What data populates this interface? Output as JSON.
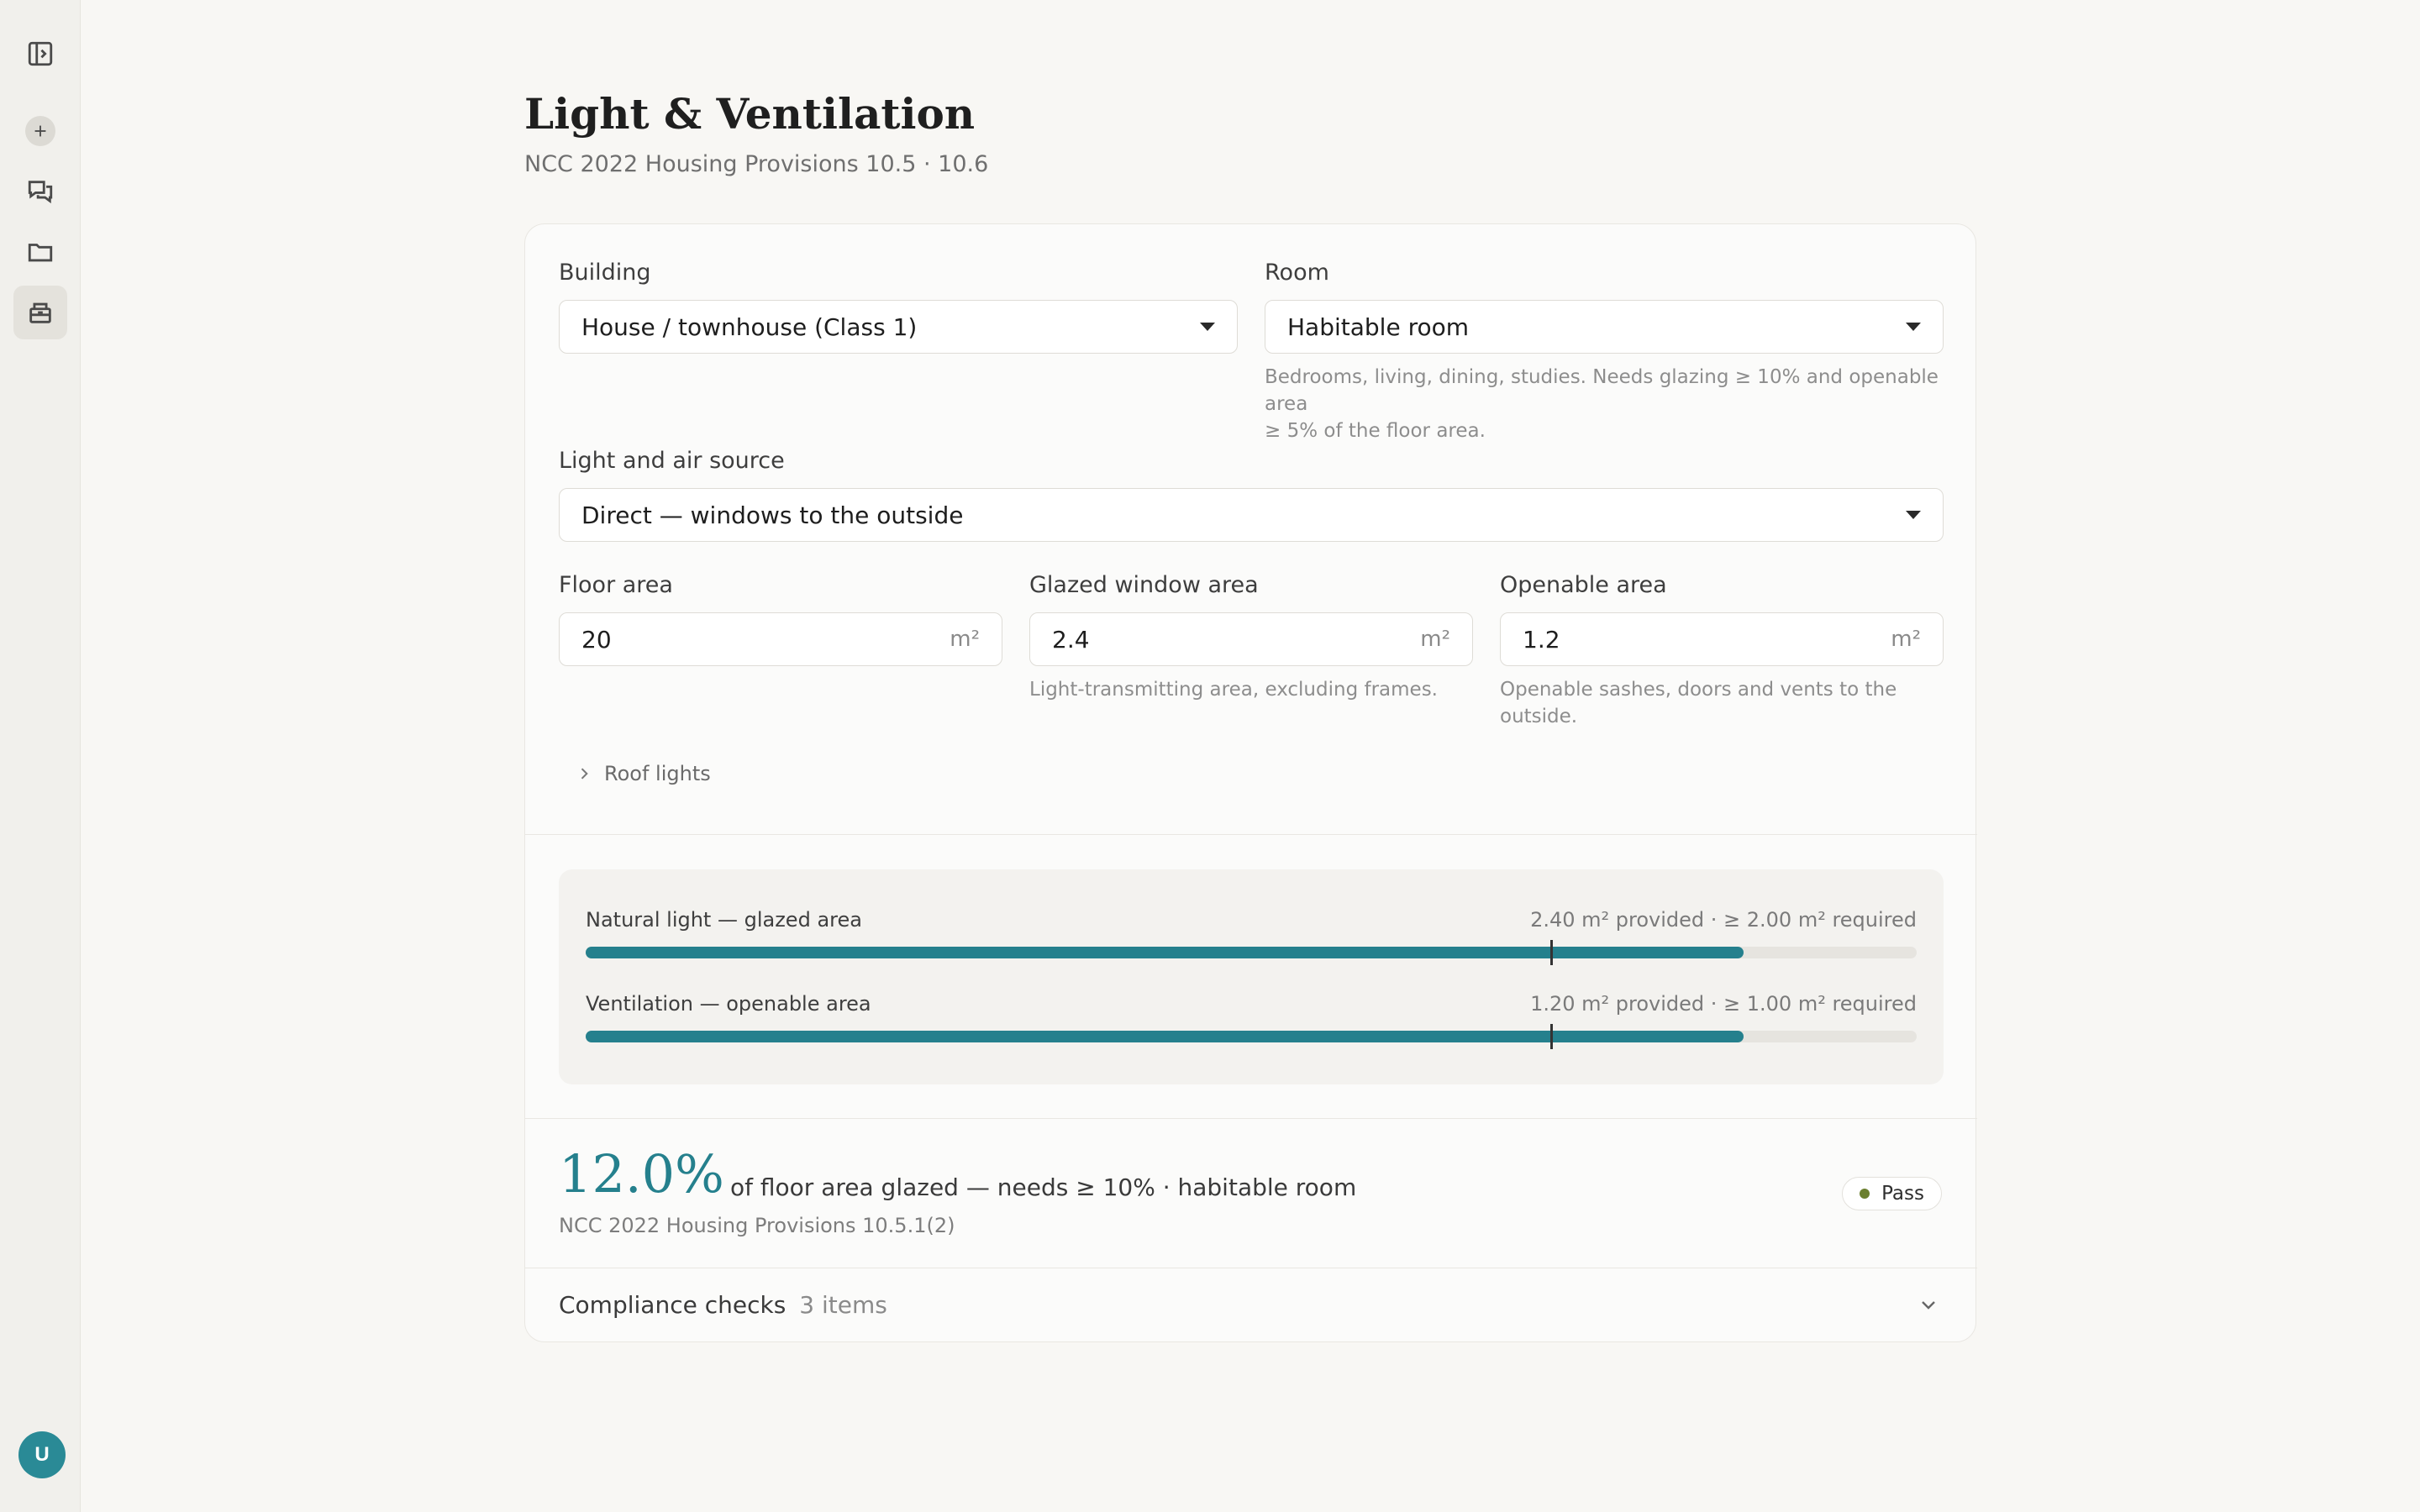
{
  "sidebar": {
    "items": [
      {
        "name": "toggle-sidebar-icon"
      },
      {
        "name": "new-chat-icon"
      },
      {
        "name": "chats-icon"
      },
      {
        "name": "projects-icon"
      },
      {
        "name": "tools-icon"
      }
    ],
    "avatar_initial": "U"
  },
  "header": {
    "title": "Light & Ventilation",
    "subtitle": "NCC 2022 Housing Provisions 10.5 · 10.6"
  },
  "form": {
    "building": {
      "label": "Building",
      "value": "House / townhouse (Class 1)"
    },
    "room": {
      "label": "Room",
      "value": "Habitable room",
      "help_line1": "Bedrooms, living, dining, studies. Needs glazing ≥ 10% and openable area",
      "help_line2": "≥ 5% of the floor area."
    },
    "source": {
      "label": "Light and air source",
      "value": "Direct — windows to the outside"
    },
    "floor_area": {
      "label": "Floor area",
      "value": "20",
      "unit": "m²"
    },
    "glazed_area": {
      "label": "Glazed window area",
      "value": "2.4",
      "unit": "m²",
      "help": "Light-transmitting area, excluding frames."
    },
    "openable_area": {
      "label": "Openable area",
      "value": "1.2",
      "unit": "m²",
      "help_line1": "Openable sashes, doors and vents to the",
      "help_line2": "outside."
    },
    "roof_lights_label": "Roof lights"
  },
  "meters": [
    {
      "label": "Natural light — glazed area",
      "readout": "2.40 m² provided · ≥ 2.00 m² required",
      "fill_fraction": 0.87,
      "threshold_fraction": 0.725
    },
    {
      "label": "Ventilation — openable area",
      "readout": "1.20 m² provided · ≥ 1.00 m² required",
      "fill_fraction": 0.87,
      "threshold_fraction": 0.725
    }
  ],
  "result": {
    "percent": "12.0%",
    "text": "of floor area glazed — needs ≥ 10% · habitable room",
    "reference": "NCC 2022 Housing Provisions 10.5.1(2)",
    "status": "Pass",
    "status_color": "#6b7f2f"
  },
  "compliance": {
    "label": "Compliance checks",
    "count": "3 items"
  },
  "colors": {
    "accent": "#25808d",
    "background": "#f8f7f4"
  }
}
